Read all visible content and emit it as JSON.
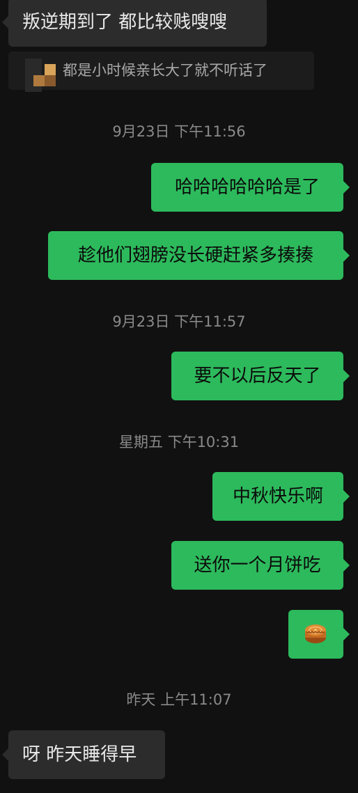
{
  "messages": [
    {
      "side": "left",
      "text": "叛逆期到了 都比较贱嗖嗖"
    },
    {
      "quote": "都是小时候亲长大了就不听话了"
    },
    {
      "timestamp": "9月23日 下午11:56"
    },
    {
      "side": "right",
      "text": "哈哈哈哈哈哈是了"
    },
    {
      "side": "right",
      "text": "趁他们翅膀没长硬赶紧多揍揍"
    },
    {
      "timestamp": "9月23日 下午11:57"
    },
    {
      "side": "right",
      "text": "要不以后反天了"
    },
    {
      "timestamp": "星期五 下午10:31"
    },
    {
      "side": "right",
      "text": "中秋快乐啊"
    },
    {
      "side": "right",
      "text": "送你一个月饼吃"
    },
    {
      "side": "right",
      "emoji": "mooncake-icon"
    },
    {
      "timestamp": "昨天 上午11:07"
    },
    {
      "side": "left",
      "text": "呀 昨天睡得早"
    }
  ],
  "colors": {
    "background": "#111111",
    "incoming_bubble": "#2c2c2c",
    "outgoing_bubble": "#2dba5c",
    "timestamp_text": "#8a8a8a"
  }
}
